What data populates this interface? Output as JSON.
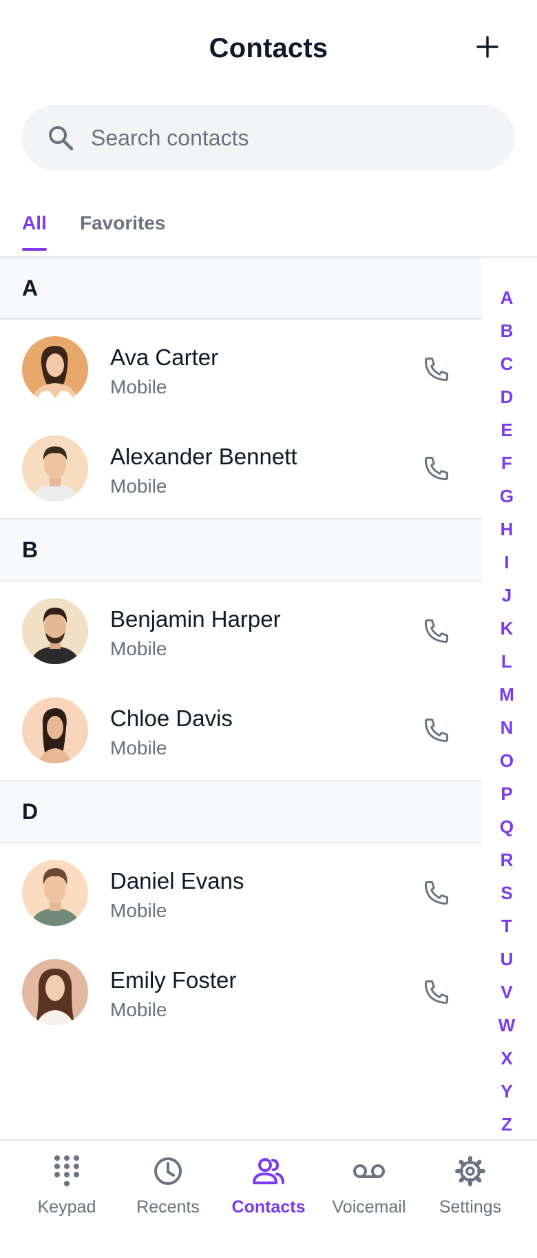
{
  "header": {
    "title": "Contacts",
    "add_icon": "plus-icon"
  },
  "search": {
    "placeholder": "Search contacts",
    "value": ""
  },
  "tabs": [
    {
      "label": "All",
      "active": true
    },
    {
      "label": "Favorites",
      "active": false
    }
  ],
  "sections": [
    {
      "letter": "A",
      "contacts": [
        {
          "name": "Ava Carter",
          "type": "Mobile"
        },
        {
          "name": "Alexander Bennett",
          "type": "Mobile"
        }
      ]
    },
    {
      "letter": "B",
      "contacts": [
        {
          "name": "Benjamin Harper",
          "type": "Mobile"
        },
        {
          "name": "Chloe Davis",
          "type": "Mobile"
        }
      ]
    },
    {
      "letter": "D",
      "contacts": [
        {
          "name": "Daniel Evans",
          "type": "Mobile"
        },
        {
          "name": "Emily Foster",
          "type": "Mobile"
        }
      ]
    }
  ],
  "alphabet": [
    "A",
    "B",
    "C",
    "D",
    "E",
    "F",
    "G",
    "H",
    "I",
    "J",
    "K",
    "L",
    "M",
    "N",
    "O",
    "P",
    "Q",
    "R",
    "S",
    "T",
    "U",
    "V",
    "W",
    "X",
    "Y",
    "Z"
  ],
  "bottom_nav": [
    {
      "label": "Keypad",
      "icon": "keypad-icon",
      "active": false
    },
    {
      "label": "Recents",
      "icon": "clock-icon",
      "active": false
    },
    {
      "label": "Contacts",
      "icon": "contacts-icon",
      "active": true
    },
    {
      "label": "Voicemail",
      "icon": "voicemail-icon",
      "active": false
    },
    {
      "label": "Settings",
      "icon": "gear-icon",
      "active": false
    }
  ],
  "colors": {
    "accent": "#7c3aed",
    "muted": "#6b7280",
    "text": "#111827",
    "section_bg": "#f8f9fb"
  }
}
